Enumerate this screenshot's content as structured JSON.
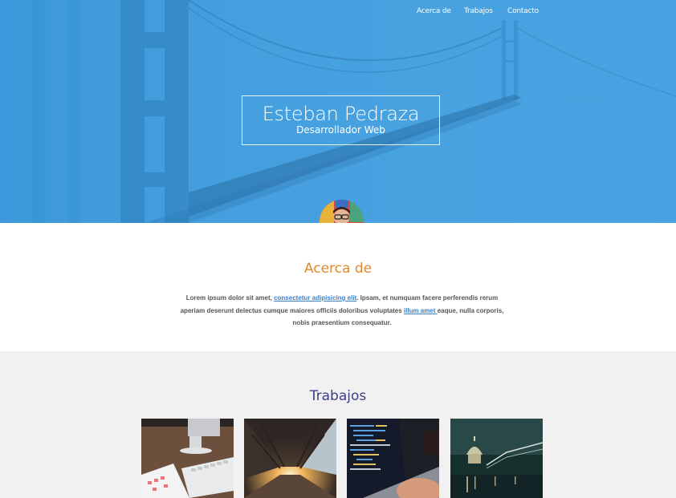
{
  "nav": {
    "items": [
      "Acerca de",
      "Trabajos",
      "Contacto"
    ]
  },
  "hero": {
    "name": "Esteban Pedraza",
    "role": "Desarrollador Web"
  },
  "about": {
    "title": "Acerca de",
    "text_1": "Lorem ipsum dolor sit amet, ",
    "link_1": "consectetur adipisicing elit",
    "text_2": ". Ipsam, et numquam facere perferendis rerum aperiam deserunt delectus cumque maiores officiis doloribus voluptates ",
    "link_2": "illum amet ",
    "text_3": "eaque, nulla corporis, nobis praesentium consequatur."
  },
  "works": {
    "title": "Trabajos",
    "items": [
      "desk-keyboard-photo",
      "train-station-photo",
      "laptop-code-photo",
      "city-night-photo"
    ]
  },
  "colors": {
    "hero_bg": "#3d9ddf",
    "about_title": "#e0882c",
    "works_title": "#3b3d8c",
    "link": "#3d7fc7",
    "works_bg": "#f1f1f1"
  }
}
